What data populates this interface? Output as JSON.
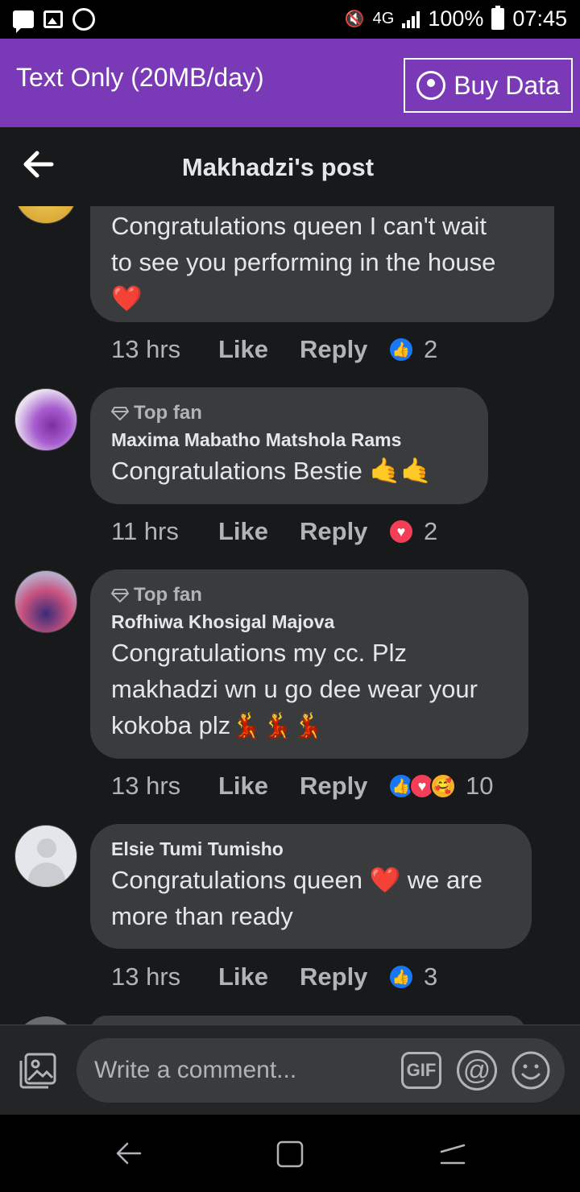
{
  "status_bar": {
    "battery": "100%",
    "time": "07:45",
    "network": "4G",
    "icons": [
      "message-icon",
      "gallery-icon",
      "whatsapp-icon",
      "mute-icon",
      "network-icon",
      "signal-icon",
      "battery-icon"
    ]
  },
  "banner": {
    "title": "Text Only (20MB/day)",
    "buy_label": "Buy Data",
    "color": "#7a39b7"
  },
  "header": {
    "title": "Makhadzi's post"
  },
  "comments": [
    {
      "author": "",
      "top_fan": false,
      "lines": [
        "Congratulations queen I can't wait",
        "to see you performing in the house"
      ],
      "emoji": "❤️",
      "time": "13 hrs",
      "like": "Like",
      "reply": "Reply",
      "reactions": [
        "like"
      ],
      "count": "2"
    },
    {
      "author": "Maxima Mabatho Matshola Rams",
      "top_fan": true,
      "top_fan_label": "Top fan",
      "text": "Congratulations Bestie 🤙🤙",
      "time": "11 hrs",
      "like": "Like",
      "reply": "Reply",
      "reactions": [
        "love"
      ],
      "count": "2"
    },
    {
      "author": "Rofhiwa Khosigal Majova",
      "top_fan": true,
      "top_fan_label": "Top fan",
      "lines": [
        "Congratulations my cc. Plz",
        "makhadzi wn u go dee wear your",
        "kokoba plz💃💃💃"
      ],
      "time": "13 hrs",
      "like": "Like",
      "reply": "Reply",
      "reactions": [
        "like",
        "love",
        "care"
      ],
      "count": "10"
    },
    {
      "author": "Elsie Tumi Tumisho",
      "top_fan": false,
      "lines": [
        "Congratulations queen ❤️ we are",
        "more than ready"
      ],
      "time": "13 hrs",
      "like": "Like",
      "reply": "Reply",
      "reactions": [
        "like"
      ],
      "count": "3"
    }
  ],
  "composer": {
    "placeholder": "Write a comment...",
    "gif_label": "GIF",
    "at_label": "@"
  },
  "colors": {
    "background": "#18191a",
    "bubble": "#3a3b3c",
    "like_blue": "#1877f2",
    "love_red": "#f33e58"
  }
}
